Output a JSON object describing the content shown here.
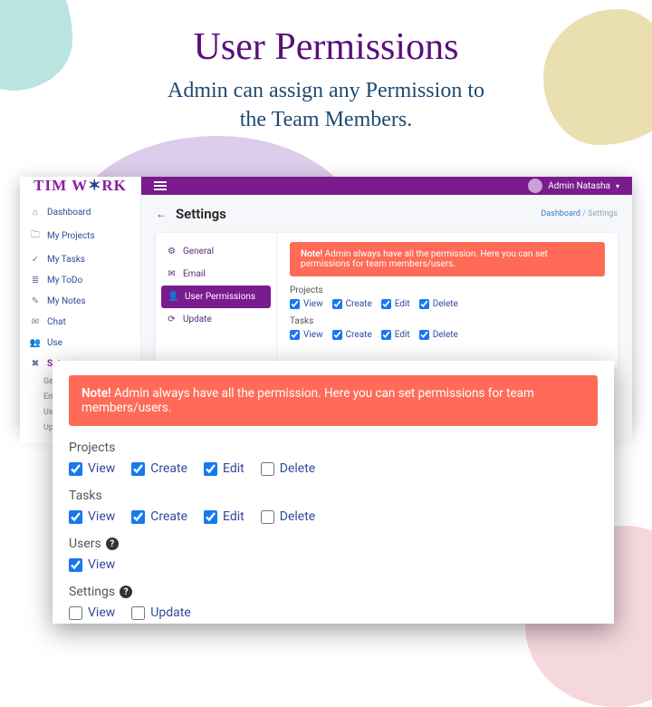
{
  "hero": {
    "title": "User Permissions",
    "subtitle_l1": "Admin can assign any Permission to",
    "subtitle_l2": "the Team Members."
  },
  "logo": {
    "part1": "TIM W",
    "star": "✶",
    "part2": "RK"
  },
  "topbar": {
    "user_name": "Admin Natasha"
  },
  "sidebar": {
    "items": [
      {
        "icon": "⌂",
        "label": "Dashboard"
      },
      {
        "icon": "🗀",
        "label": "My Projects"
      },
      {
        "icon": "✓",
        "label": "My Tasks"
      },
      {
        "icon": "≣",
        "label": "My ToDo"
      },
      {
        "icon": "✎",
        "label": "My Notes"
      },
      {
        "icon": "✉",
        "label": "Chat"
      },
      {
        "icon": "👥",
        "label": "Use"
      },
      {
        "icon": "✖",
        "label": "Set"
      }
    ],
    "subs": [
      "Ge",
      "Em",
      "Use",
      "Up"
    ]
  },
  "page": {
    "back": "←",
    "title": "Settings",
    "crumb_dash": "Dashboard",
    "crumb_sep": " / ",
    "crumb_cur": "Settings"
  },
  "tabs": [
    {
      "icon": "⚙",
      "label": "General"
    },
    {
      "icon": "✉",
      "label": "Email"
    },
    {
      "icon": "👤",
      "label": "User Permissions"
    },
    {
      "icon": "⟳",
      "label": "Update"
    }
  ],
  "alert": {
    "strong": "Note!",
    "text": " Admin always have all the permission. Here you can set permissions for team members/users."
  },
  "back_perms": {
    "groups": [
      {
        "title": "Projects",
        "items": [
          {
            "label": "View",
            "checked": true
          },
          {
            "label": "Create",
            "checked": true
          },
          {
            "label": "Edit",
            "checked": true
          },
          {
            "label": "Delete",
            "checked": true
          }
        ]
      },
      {
        "title": "Tasks",
        "items": [
          {
            "label": "View",
            "checked": true
          },
          {
            "label": "Create",
            "checked": true
          },
          {
            "label": "Edit",
            "checked": true
          },
          {
            "label": "Delete",
            "checked": true
          }
        ]
      }
    ]
  },
  "zoom_perms": {
    "groups": [
      {
        "title": "Projects",
        "help": false,
        "items": [
          {
            "label": "View",
            "checked": true
          },
          {
            "label": "Create",
            "checked": true
          },
          {
            "label": "Edit",
            "checked": true
          },
          {
            "label": "Delete",
            "checked": false
          }
        ]
      },
      {
        "title": "Tasks",
        "help": false,
        "items": [
          {
            "label": "View",
            "checked": true
          },
          {
            "label": "Create",
            "checked": true
          },
          {
            "label": "Edit",
            "checked": true
          },
          {
            "label": "Delete",
            "checked": false
          }
        ]
      },
      {
        "title": "Users",
        "help": true,
        "items": [
          {
            "label": "View",
            "checked": true
          }
        ]
      },
      {
        "title": "Settings",
        "help": true,
        "items": [
          {
            "label": "View",
            "checked": false
          },
          {
            "label": "Update",
            "checked": false
          }
        ]
      }
    ]
  }
}
